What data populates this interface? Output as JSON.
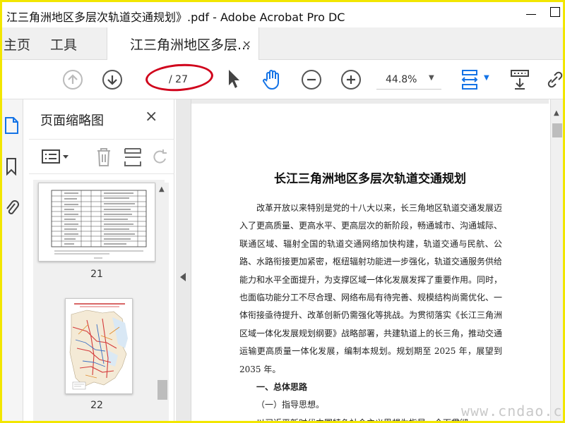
{
  "window": {
    "title": "江三角洲地区多层次轨道交通规划》.pdf - Adobe Acrobat Pro DC"
  },
  "tabs": {
    "home": "主页",
    "tools": "工具",
    "document": "江三角洲地区多层...",
    "close": "×"
  },
  "toolbar": {
    "page_current": "",
    "page_total": "/ 27",
    "zoom": "44.8%",
    "help": "?"
  },
  "panel": {
    "title": "页面缩略图",
    "close": "×"
  },
  "thumbnails": [
    {
      "label": "21"
    },
    {
      "label": "22"
    }
  ],
  "document": {
    "title": "长江三角洲地区多层次轨道交通规划",
    "paragraphs": [
      "改革开放以来特别是党的十八大以来，长三角地区轨道交通发展迈入了更高质量、更高水平、更高层次的新阶段，畅通城市、沟通城际、联通区域、辐射全国的轨道交通网络加快构建，轨道交通与民航、公路、水路衔接更加紧密，枢纽辐射功能进一步强化，轨道交通服务供给能力和水平全面提升，为支撑区域一体化发展发挥了重要作用。同时，也面临功能分工不尽合理、网络布局有待完善、规模结构尚需优化、一体衔接亟待提升、改革创新仍需强化等挑战。为贯彻落实《长江三角洲区域一体化发展规划纲要》战略部署，共建轨道上的长三角，推动交通运输更高质量一体化发展，编制本规划。规划期至 2025 年，展望到 2035 年。"
    ],
    "heading": "一、总体思路",
    "subheading": "（一）指导思想。",
    "last_line": "以习近平新时代中国特色社会主义思想为指导，全面贯彻"
  },
  "watermark": "www.cndao.com",
  "colors": {
    "frame": "#f2e600",
    "annotation_oval": "#d0021b",
    "acrobat_blue": "#1473e6"
  }
}
